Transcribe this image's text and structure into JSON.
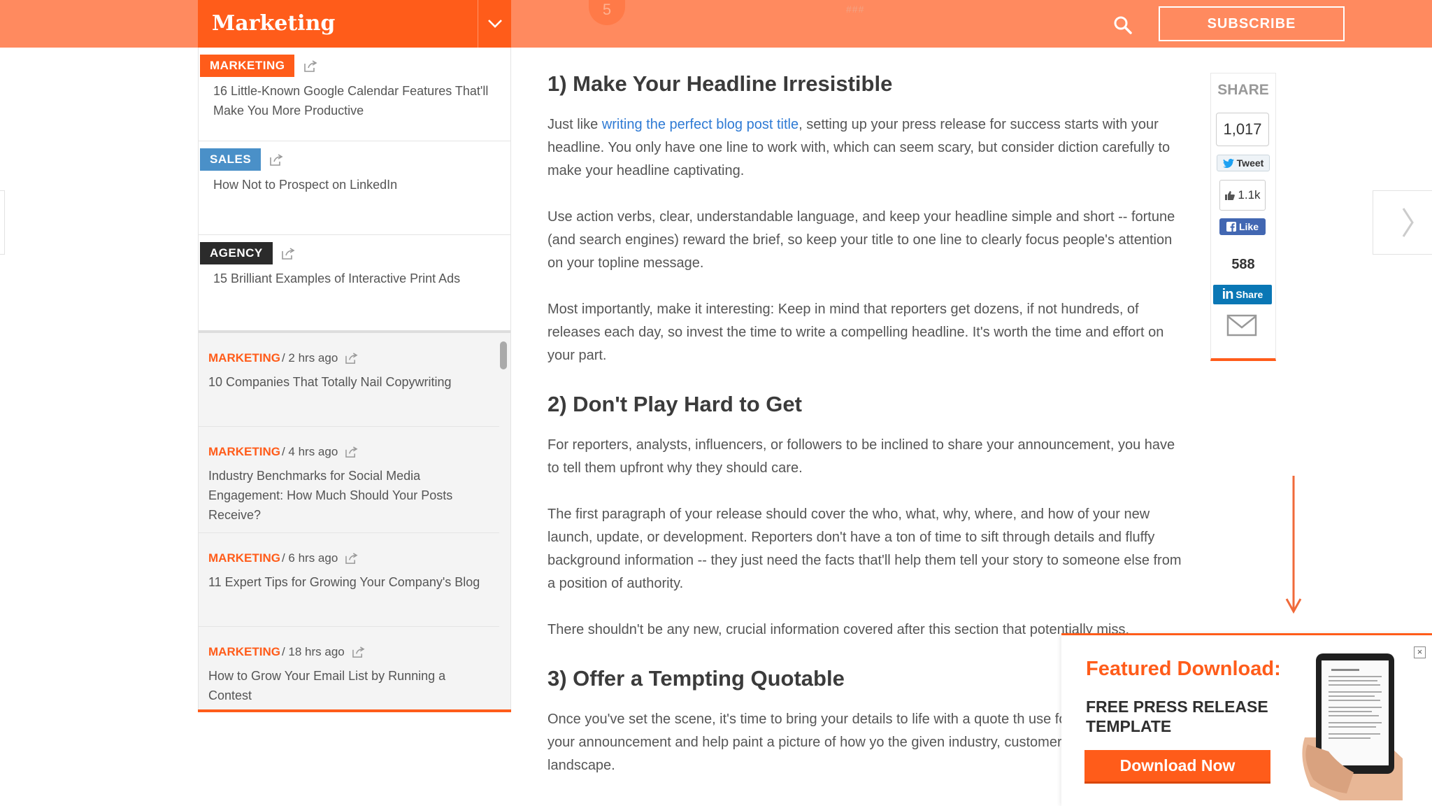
{
  "header": {
    "section": "Marketing",
    "ghost_badge": "5",
    "ghost_mark": "###",
    "subscribe_label": "SUBSCRIBE"
  },
  "sidebar": {
    "featured": [
      {
        "tag": "MARKETING",
        "tag_color": "#ff5c1a",
        "title": "16 Little-Known Google Calendar Features That'll Make You More Productive"
      },
      {
        "tag": "SALES",
        "tag_color": "#4a90c8",
        "title": "How Not to Prospect on LinkedIn"
      },
      {
        "tag": "AGENCY",
        "tag_color": "#2b2b2b",
        "title": "15 Brilliant Examples of Interactive Print Ads"
      }
    ],
    "recent": [
      {
        "category": "MARKETING",
        "time": "/ 2 hrs ago",
        "title": "10 Companies That Totally Nail Copywriting"
      },
      {
        "category": "MARKETING",
        "time": "/ 4 hrs ago",
        "title": "Industry Benchmarks for Social Media Engagement: How Much Should Your Posts Receive?"
      },
      {
        "category": "MARKETING",
        "time": "/ 6 hrs ago",
        "title": "11 Expert Tips for Growing Your Company's Blog"
      },
      {
        "category": "MARKETING",
        "time": "/ 18 hrs ago",
        "title": "How to Grow Your Email List by Running a Contest"
      }
    ]
  },
  "article": {
    "h1": "1) Make Your Headline Irresistible",
    "p1_pre": "Just like ",
    "p1_link": "writing the perfect blog post title",
    "p1_post": ", setting up your press release for success starts with your headline. You only have one line to work with, which can seem scary, but consider diction carefully to make your headline captivating.",
    "p2": "Use action verbs, clear, understandable language, and keep your headline simple and short -- fortune (and search engines) reward the brief, so keep your title to one line to clearly focus people's attention on your topline message.",
    "p3": "Most importantly, make it interesting: Keep in mind that reporters get dozens, if not hundreds, of releases each day, so invest the time to write a compelling headline. It's worth the time and effort on your part.",
    "h2": "2) Don't Play Hard to Get",
    "p4": "For reporters, analysts, influencers, or followers to be inclined to share your announcement, you have to tell them upfront why they should care.",
    "p5": "The first paragraph of your release should cover the who, what, why, where, and how of your new launch, update, or development. Reporters don't have a ton of time to sift through details and fluffy background information -- they just need the facts that'll help them tell your story to someone else from a position of authority.",
    "p6": "There shouldn't be any new, crucial information covered after this section that potentially miss.",
    "h3": "3) Offer a Tempting Quotable",
    "p7": "Once you've set the scene, it's time to bring your details to life with a quote th use for context around your announcement and help paint a picture of how yo the given industry, customer base, and landscape."
  },
  "share": {
    "title": "SHARE",
    "total": "1,017",
    "tweet": "Tweet",
    "like_count": "1.1k",
    "like": "Like",
    "linkedin_count": "588",
    "linkedin": "Share"
  },
  "featured_download": {
    "title": "Featured Download:",
    "subtitle": "FREE PRESS RELEASE TEMPLATE",
    "button": "Download Now",
    "close": "×"
  }
}
